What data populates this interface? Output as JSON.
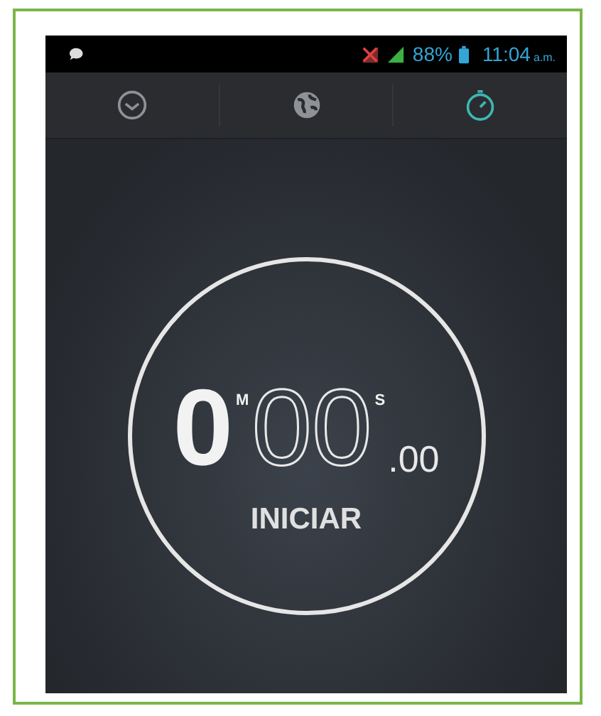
{
  "status_bar": {
    "battery": "88%",
    "time": "11:04",
    "period": "a.m."
  },
  "tabs": [
    {
      "kind": "clock",
      "selected": false
    },
    {
      "kind": "globe",
      "selected": false
    },
    {
      "kind": "stopwatch",
      "selected": true
    }
  ],
  "stopwatch": {
    "minutes": "0",
    "minutes_unit": "M",
    "seconds": "00",
    "seconds_unit": "S",
    "hundredths": ".00",
    "action": "INICIAR"
  }
}
